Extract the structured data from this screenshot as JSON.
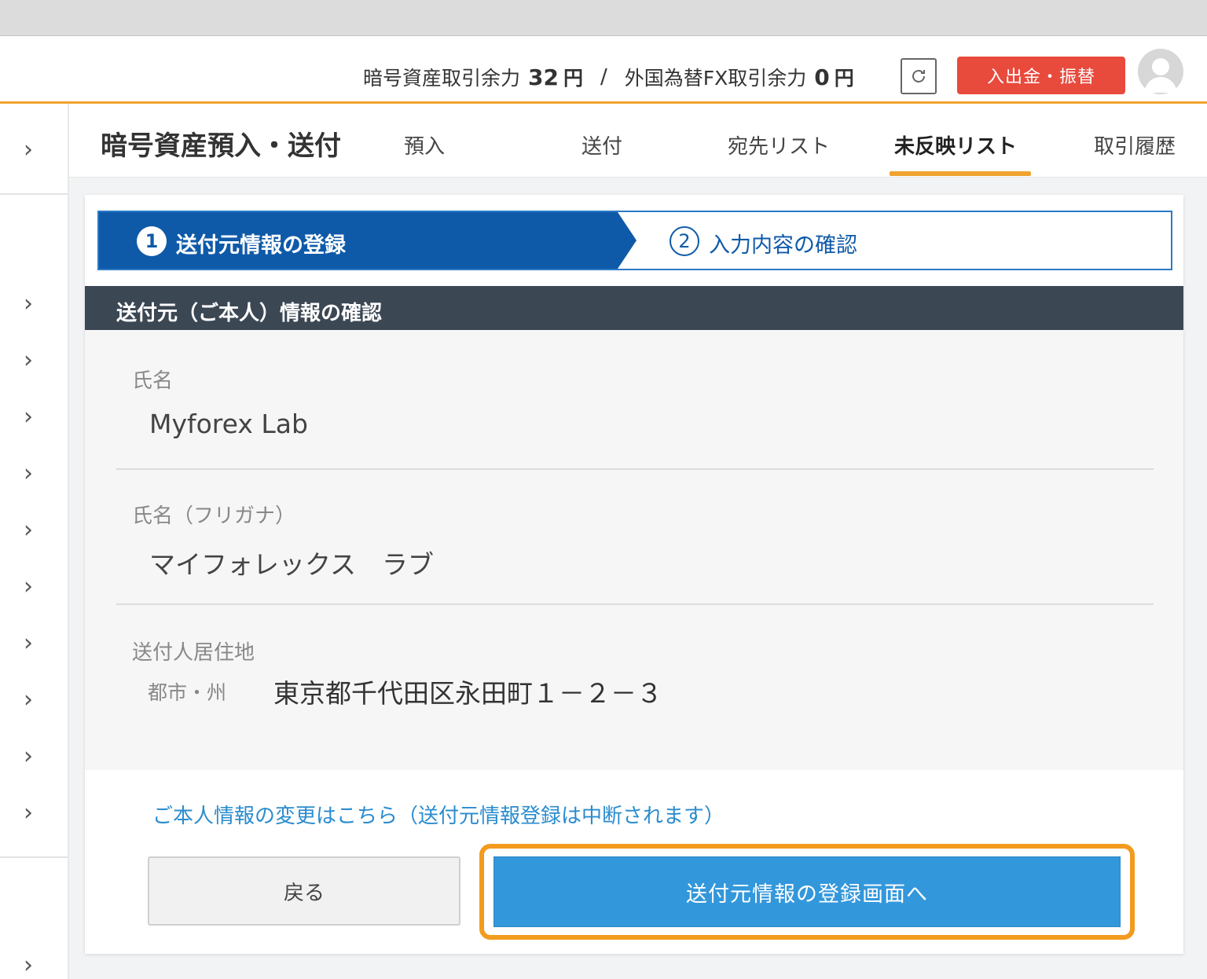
{
  "header": {
    "crypto_label": "暗号資産取引余力",
    "crypto_value": "32",
    "crypto_unit": "円",
    "separator": "/",
    "fx_label": "外国為替FX取引余力",
    "fx_value": "0",
    "fx_unit": "円",
    "deposit_button": "入出金・振替"
  },
  "page": {
    "title": "暗号資産預入・送付",
    "tabs": [
      {
        "label": "預入",
        "active": false
      },
      {
        "label": "送付",
        "active": false
      },
      {
        "label": "宛先リスト",
        "active": false
      },
      {
        "label": "未反映リスト",
        "active": true
      },
      {
        "label": "取引履歴",
        "active": false
      }
    ]
  },
  "stepper": {
    "step1": {
      "number": "1",
      "label": "送付元情報の登録"
    },
    "step2": {
      "number": "2",
      "label": "入力内容の確認"
    }
  },
  "section": {
    "title": "送付元（ご本人）情報の確認",
    "fields": [
      {
        "label": "氏名",
        "value": "Myforex Lab"
      },
      {
        "label": "氏名（フリガナ）",
        "value": "マイフォレックス　ラブ"
      }
    ],
    "address": {
      "label": "送付人居住地",
      "sub_label": "都市・州",
      "value": "東京都千代田区永田町１－２－３"
    }
  },
  "actions": {
    "change_link": "ご本人情報の変更はこちら（送付元情報登録は中断されます）",
    "back_button": "戻る",
    "next_button": "送付元情報の登録画面へ"
  },
  "sidebar": {
    "items": [
      "›",
      "›",
      "›",
      "›",
      "›",
      "›",
      "›",
      "›",
      "›",
      "›",
      "›",
      "›"
    ]
  },
  "colors": {
    "accent_orange": "#f0a32f",
    "step_active_blue": "#0f5aa8",
    "primary_button": "#3397db",
    "deposit_red": "#e84a3c",
    "section_header": "#3c4754",
    "link_blue": "#2a8ccf"
  },
  "icons": {
    "refresh": "refresh-icon",
    "avatar": "user-avatar-icon",
    "sidebar_chevron": "chevron-right-icon"
  }
}
